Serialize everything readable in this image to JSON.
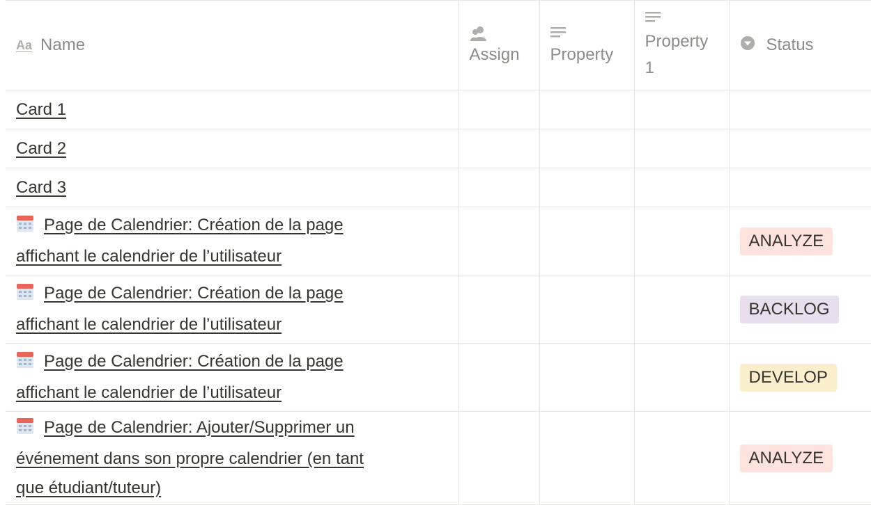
{
  "columns": {
    "name": {
      "label": "Name",
      "icon": "text-type-icon",
      "icon_text": "Aa"
    },
    "assign": {
      "label": "Assign",
      "icon": "person-icon"
    },
    "property": {
      "label": "Property",
      "icon": "text-lines-icon"
    },
    "property1": {
      "label_line1": "Property",
      "label_line2": "1",
      "icon": "text-lines-icon"
    },
    "status": {
      "label": "Status",
      "icon": "select-dropdown-icon"
    }
  },
  "rows": [
    {
      "name": "Card 1",
      "status": ""
    },
    {
      "name": "Card 2",
      "status": ""
    },
    {
      "name": "Card 3",
      "status": ""
    },
    {
      "icon": "calendar-icon",
      "name_line1": "Page de Calendrier: Création de la page",
      "name_line2": "affichant le calendrier de l’utilisateur",
      "status": "ANALYZE",
      "status_color": "#fde2dd"
    },
    {
      "icon": "calendar-icon",
      "name_line1": "Page de Calendrier: Création de la page",
      "name_line2": "affichant le calendrier de l’utilisateur",
      "status": "BACKLOG",
      "status_color": "#e8deee"
    },
    {
      "icon": "calendar-icon",
      "name_line1": "Page de Calendrier: Création de la page",
      "name_line2": "affichant le calendrier de l’utilisateur",
      "status": "DEVELOP",
      "status_color": "#fbeecc"
    },
    {
      "icon": "calendar-icon",
      "name_line1": "Page de Calendrier: Ajouter/Supprimer un",
      "name_line2": "événement dans son propre calendrier (en tant",
      "name_line3": "que étudiant/tuteur)",
      "status": "ANALYZE",
      "status_color": "#fde2dd"
    }
  ]
}
